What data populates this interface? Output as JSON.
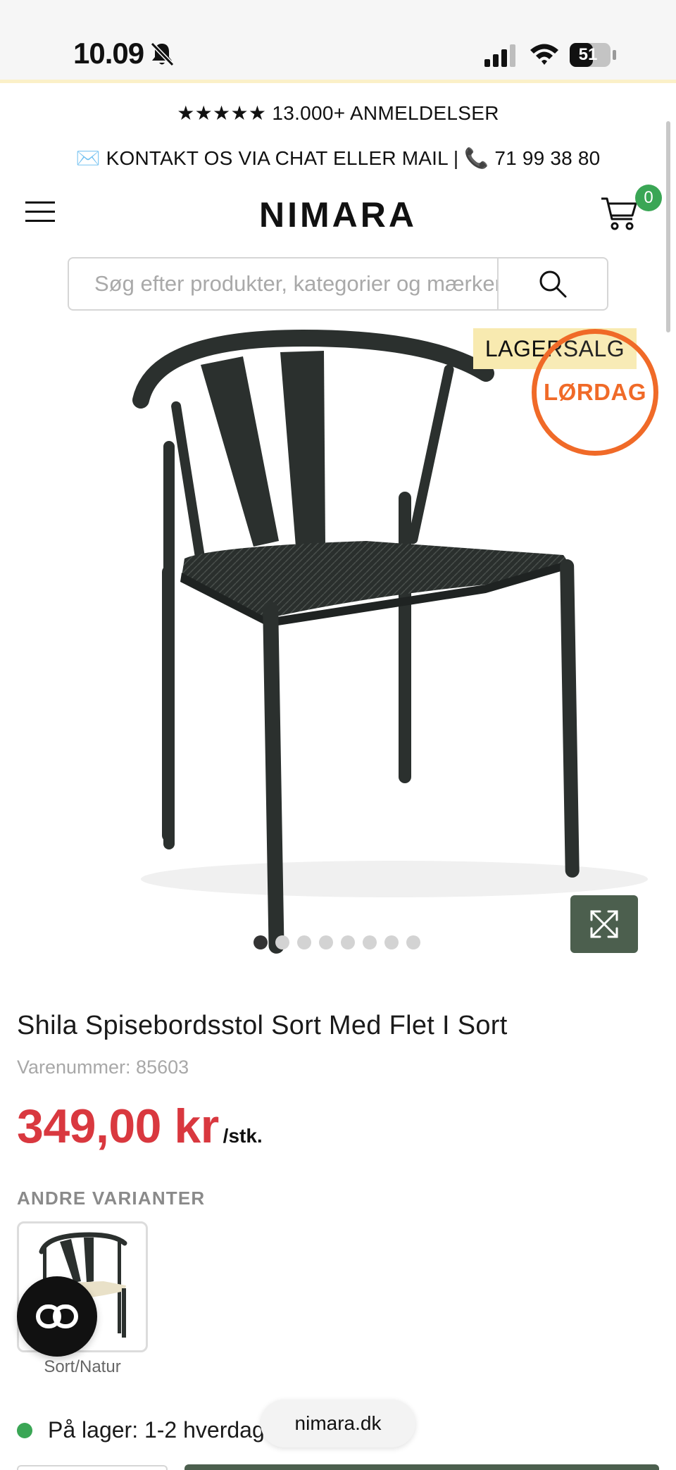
{
  "status_bar": {
    "time": "10.09",
    "battery": "51"
  },
  "announcement": {
    "reviews": "★★★★★ 13.000+ ANMELDELSER",
    "contact": "✉️ KONTAKT OS VIA CHAT ELLER MAIL | 📞 71 99 38 80"
  },
  "header": {
    "logo": "NIMARA",
    "cart_count": "0"
  },
  "search": {
    "placeholder": "Søg efter produkter, kategorier og mærker"
  },
  "badges": {
    "lagersalg": "LAGERSALG",
    "lordag": "LØRDAG"
  },
  "carousel": {
    "total": 8,
    "active_index": 0
  },
  "product": {
    "title": "Shila Spisebordsstol Sort Med Flet I Sort",
    "sku": "Varenummer: 85603",
    "price": "349,00 kr",
    "unit": "/stk."
  },
  "variants": {
    "heading": "ANDRE VARIANTER",
    "items": [
      {
        "label": "Sort/Natur"
      }
    ]
  },
  "stock": {
    "text": "På lager: 1-2 hverdage"
  },
  "browser": {
    "url": "nimara.dk"
  },
  "colors": {
    "price_red": "#d9383f",
    "accent_green": "#3aa655",
    "dark_green_button": "#4c5f4e",
    "badge_yellow": "#f8eab0",
    "badge_orange": "#f06a28"
  }
}
